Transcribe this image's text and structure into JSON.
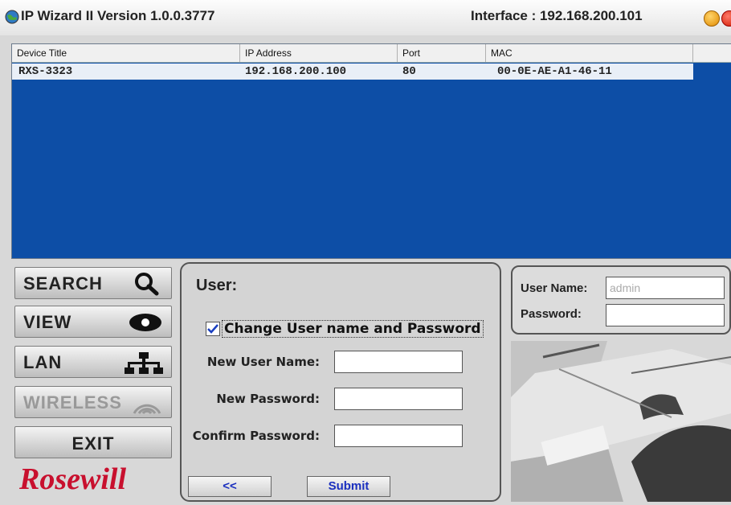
{
  "window": {
    "title": "IP Wizard II  Version 1.0.0.3777",
    "interface_label": "Interface : 192.168.200.101"
  },
  "device_list": {
    "columns": [
      "Device Title",
      "IP Address",
      "Port",
      "MAC"
    ],
    "rows": [
      {
        "title": "RXS-3323",
        "ip": "192.168.200.100",
        "port": "80",
        "mac": "00-0E-AE-A1-46-11"
      }
    ]
  },
  "nav": {
    "search": "SEARCH",
    "view": "VIEW",
    "lan": "LAN",
    "wireless": "WIRELESS",
    "exit": "EXIT"
  },
  "brand": {
    "logo_text": "Rosewill"
  },
  "user_panel": {
    "title": "User:",
    "change_checkbox_label": "Change User name and Password",
    "change_checked": true,
    "new_user_label": "New User Name:",
    "new_password_label": "New Password:",
    "confirm_password_label": "Confirm Password:",
    "back_button": "<<",
    "submit_button": "Submit"
  },
  "login_panel": {
    "username_label": "User Name:",
    "username_value": "admin",
    "password_label": "Password:"
  },
  "colors": {
    "list_background": "#0d4ea6",
    "accent_button_text": "#1a2fbf",
    "logo_red": "#c8102e"
  }
}
